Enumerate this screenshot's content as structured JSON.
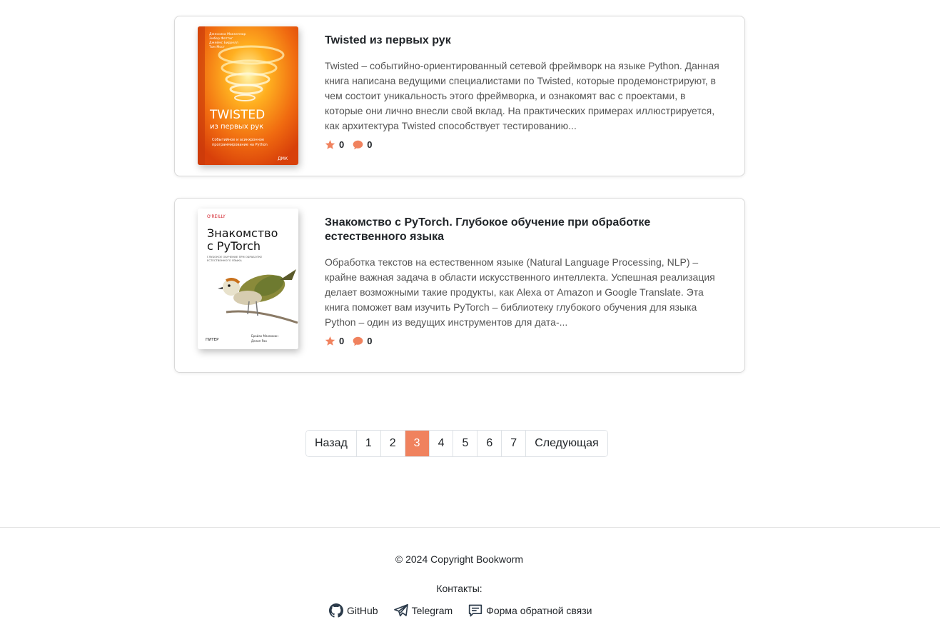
{
  "books": [
    {
      "title": "Twisted из первых рук",
      "description": "Twisted – событийно-ориентированный сетевой фреймворк на языке Python. Данная книга написана ведущими специалистами по Twisted, которые продемонстрируют, в чем состоит уникальность этого фреймворка, и ознакомят вас с проектами, в которые они лично внесли свой вклад. На практических примерах иллюстрируется, как архитектура Twisted способствует тестированию...",
      "rating": "0",
      "comments": "0",
      "cover": {
        "authors": "Джессика Маккеллар, Эмбер Феттиг, Джеймс Биррелл, Том Мост",
        "title_main": "TWISTED",
        "title_sub": "из первых рук",
        "subtitle": "Событийное и асинхронное программирование на Python",
        "publisher": "ДМК"
      }
    },
    {
      "title": "Знакомство с PyTorch. Глубокое обучение при обработке естественного языка",
      "description": "Обработка текстов на естественном языке (Natural Language Processing, NLP) – крайне важная задача в области искусственного интеллекта. Успешная реализация делает возможными такие продукты, как Alexa от Amazon и Google Translate. Эта книга поможет вам изучить PyTorch – библиотеку глубокого обучения для языка Python – один из ведущих инструментов для дата-...",
      "rating": "0",
      "comments": "0",
      "cover": {
        "publisher_top": "O'REILLY",
        "title_main": "Знакомство с PyTorch",
        "subtitle": "ГЛУБОКОЕ ОБУЧЕНИЕ ПРИ ОБРАБОТКЕ ЕСТЕСТВЕННОГО ЯЗЫКА",
        "publisher": "ПИТЕР",
        "authors": "Брайан Макмахан, Делип Рао"
      }
    }
  ],
  "pagination": {
    "prev": "Назад",
    "pages": [
      "1",
      "2",
      "3",
      "4",
      "5",
      "6",
      "7"
    ],
    "active": "3",
    "next": "Следующая"
  },
  "footer": {
    "copyright": "© 2024 Copyright Bookworm",
    "contacts_label": "Контакты:",
    "links": [
      {
        "label": "GitHub",
        "icon": "github-icon"
      },
      {
        "label": "Telegram",
        "icon": "telegram-icon"
      },
      {
        "label": "Форма обратной связи",
        "icon": "feedback-icon"
      }
    ]
  },
  "colors": {
    "accent": "#f0825e",
    "star": "#f0825e",
    "comment": "#f0825e"
  }
}
